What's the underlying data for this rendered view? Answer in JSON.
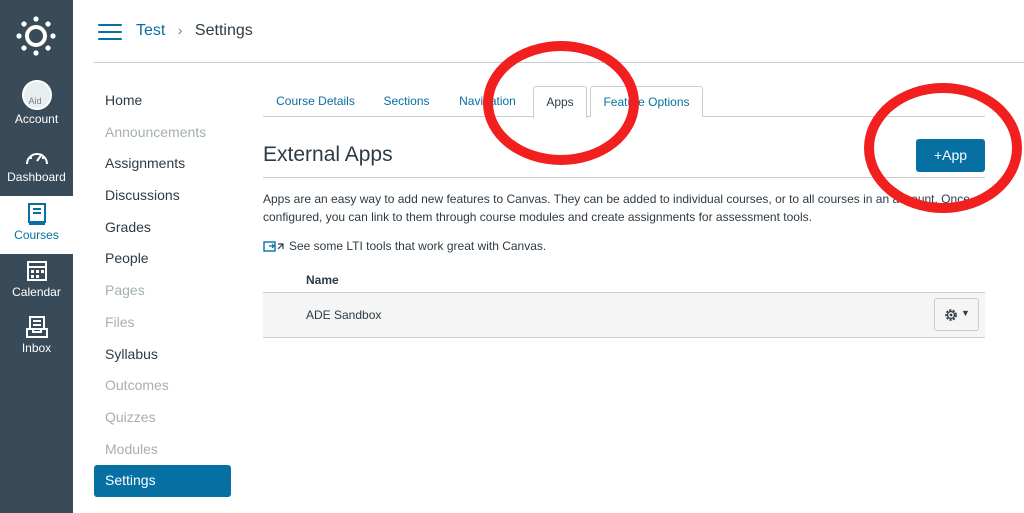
{
  "global_nav": {
    "items": [
      {
        "label": "Account",
        "icon": "avatar",
        "avatar_text": "Aid"
      },
      {
        "label": "Dashboard",
        "icon": "dashboard-icon"
      },
      {
        "label": "Courses",
        "icon": "courses-icon",
        "active": true
      },
      {
        "label": "Calendar",
        "icon": "calendar-icon"
      },
      {
        "label": "Inbox",
        "icon": "inbox-icon"
      }
    ],
    "colors": {
      "background": "#394b58",
      "active_text": "#0770a3"
    }
  },
  "breadcrumb": {
    "course": "Test",
    "separator": "›",
    "current": "Settings"
  },
  "course_nav": {
    "items": [
      {
        "label": "Home",
        "disabled": false
      },
      {
        "label": "Announcements",
        "disabled": true
      },
      {
        "label": "Assignments",
        "disabled": false
      },
      {
        "label": "Discussions",
        "disabled": false
      },
      {
        "label": "Grades",
        "disabled": false
      },
      {
        "label": "People",
        "disabled": false
      },
      {
        "label": "Pages",
        "disabled": true
      },
      {
        "label": "Files",
        "disabled": true
      },
      {
        "label": "Syllabus",
        "disabled": false
      },
      {
        "label": "Outcomes",
        "disabled": true
      },
      {
        "label": "Quizzes",
        "disabled": true
      },
      {
        "label": "Modules",
        "disabled": true
      },
      {
        "label": "Settings",
        "active": true
      }
    ]
  },
  "tabs": [
    {
      "label": "Course Details"
    },
    {
      "label": "Sections"
    },
    {
      "label": "Navigation"
    },
    {
      "label": "Apps",
      "active": true
    },
    {
      "label": "Feature Options"
    }
  ],
  "external_apps": {
    "title": "External Apps",
    "add_button": {
      "plus": "+",
      "label": "App"
    },
    "description": "Apps are an easy way to add new features to Canvas. They can be added to individual courses, or to all courses in an account. Once configured, you can link to them through course modules and create assignments for assessment tools.",
    "lti_link": "See some LTI tools that work great with Canvas.",
    "table": {
      "columns": [
        "Name"
      ],
      "rows": [
        {
          "name": "ADE Sandbox"
        }
      ]
    }
  },
  "theme": {
    "primary": "#0770a3",
    "annotation_red": "#f21f1f"
  }
}
